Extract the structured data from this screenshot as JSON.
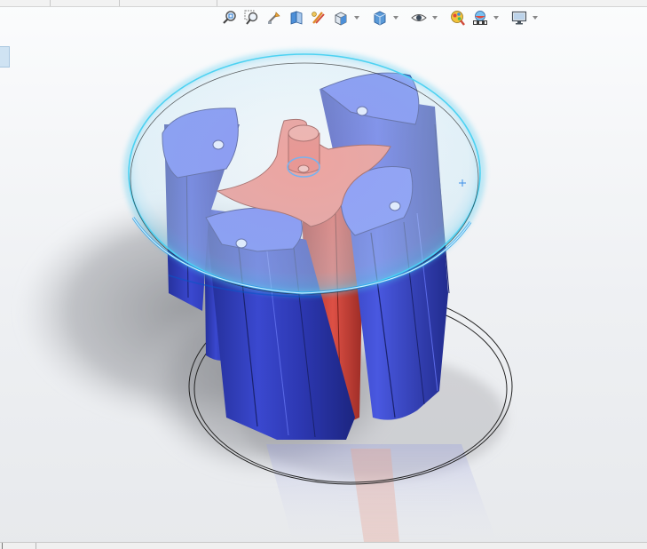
{
  "app": {
    "title": ""
  },
  "heads_up_toolbar": {
    "buttons": [
      {
        "icon": "zoom-to-fit-icon",
        "has_menu": false
      },
      {
        "icon": "zoom-to-area-icon",
        "has_menu": false
      },
      {
        "icon": "previous-view-icon",
        "has_menu": false
      },
      {
        "icon": "section-view-icon",
        "has_menu": false
      },
      {
        "icon": "dynamic-annotation-views-icon",
        "has_menu": false
      },
      {
        "icon": "view-orientation-icon",
        "has_menu": true
      },
      {
        "icon": "display-style-icon",
        "has_menu": true
      },
      {
        "icon": "hide-show-items-icon",
        "has_menu": true
      },
      {
        "icon": "edit-appearance-icon",
        "has_menu": false
      },
      {
        "icon": "apply-scene-icon",
        "has_menu": true
      },
      {
        "icon": "view-settings-icon",
        "has_menu": true
      }
    ]
  },
  "model": {
    "part_colors": {
      "blue_core": "#3c4ad6",
      "blue_dark": "#232e96",
      "blue_top": "#6070f0",
      "red_core": "#e4584d",
      "red_top": "#ef7a70",
      "selection_glow": "#46c8ee"
    }
  }
}
